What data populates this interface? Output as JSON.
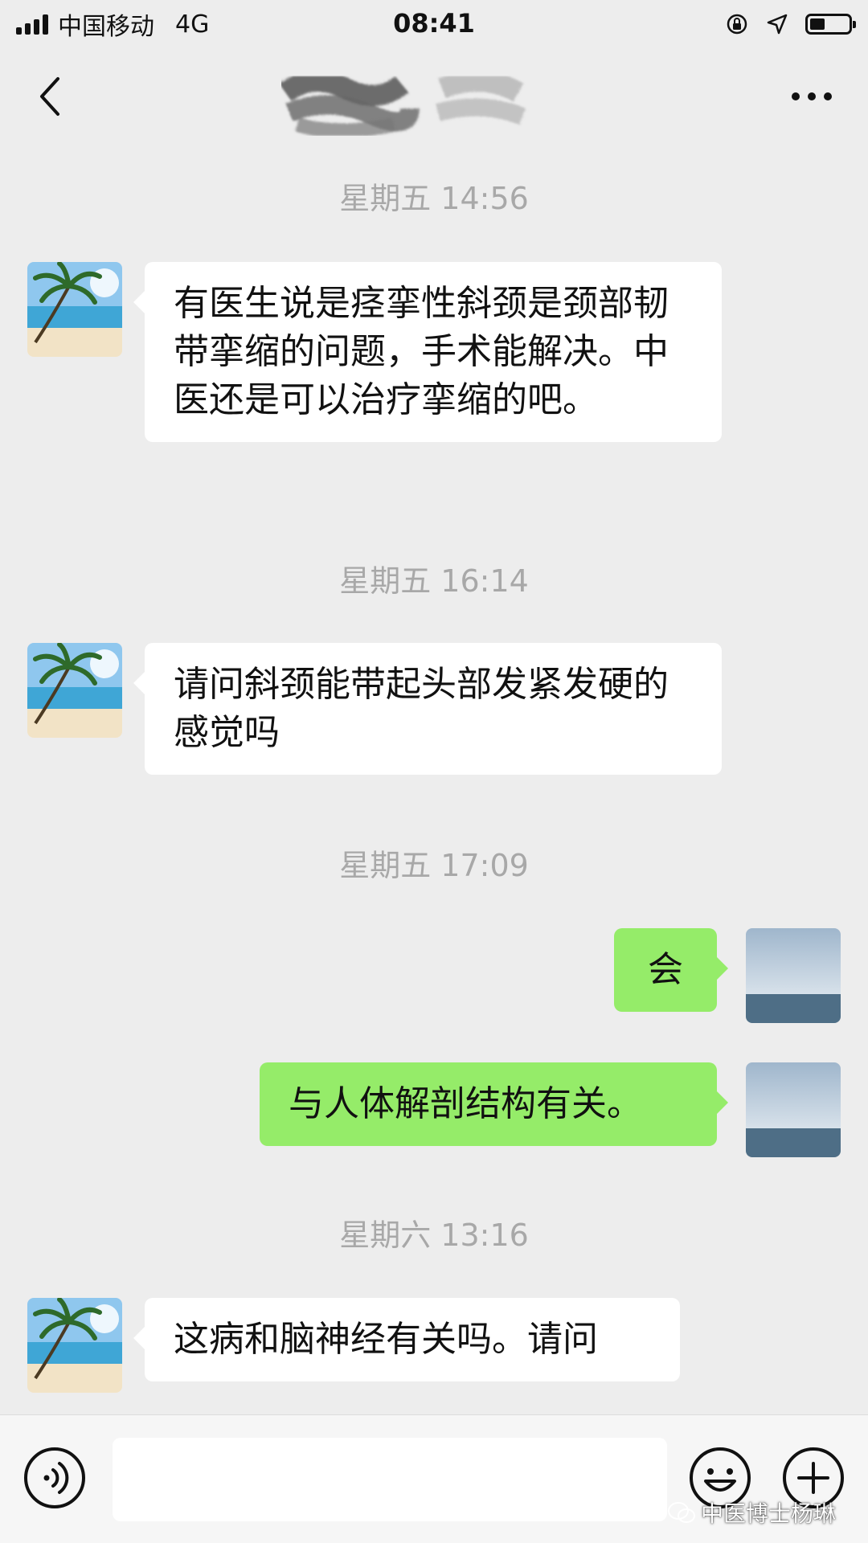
{
  "status_bar": {
    "carrier": "中国移动",
    "network": "4G",
    "time": "08:41",
    "icons": [
      "orientation-lock-icon",
      "location-icon",
      "battery-icon"
    ],
    "battery_level": 0.4
  },
  "nav_bar": {
    "back_icon": "chevron-left-icon",
    "more_icon": "more-icon"
  },
  "messages": [
    {
      "timestamp": "星期五 14:56"
    },
    {
      "text": "有医生说是痉挛性斜颈是颈部韧带挛缩的问题，手术能解决。中医还是可以治疗挛缩的吧。"
    },
    {
      "timestamp": "星期五 16:14"
    },
    {
      "text": "请问斜颈能带起头部发紧发硬的感觉吗"
    },
    {
      "timestamp": "星期五 17:09"
    },
    {
      "text": "会"
    },
    {
      "text": "与人体解剖结构有关。"
    },
    {
      "timestamp": "星期六 13:16"
    },
    {
      "text": "这病和脑神经有关吗。请问"
    }
  ],
  "input_bar": {
    "voice_icon": "voice-icon",
    "input_value": "",
    "emoji_icon": "emoji-icon",
    "plus_icon": "plus-icon"
  },
  "watermark": {
    "text": "中医博士杨琳"
  },
  "colors": {
    "background": "#EDEDED",
    "incoming_bubble": "#FFFFFF",
    "outgoing_bubble": "#95EC69",
    "timestamp": "#A8A8A8"
  }
}
